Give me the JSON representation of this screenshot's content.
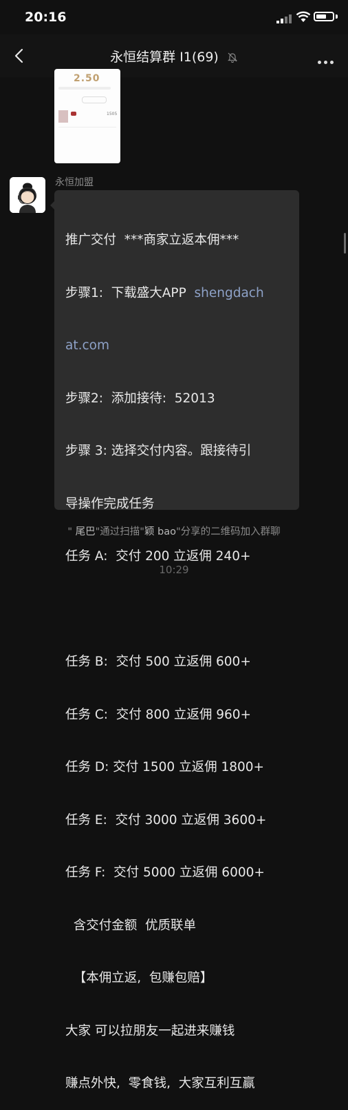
{
  "status": {
    "time": "20:16"
  },
  "nav": {
    "title": "永恒结算群 I1(69)"
  },
  "image_card": {
    "value": "2.50",
    "number": "1505"
  },
  "message": {
    "sender": "永恒加盟",
    "lines": [
      "推广交付  ***商家立返本佣***",
      "步骤1:  下载盛大APP  ",
      "at.com",
      "步骤2:  添加接待:  52013",
      "步骤 3: 选择交付内容。跟接待引",
      "导操作完成任务",
      "任务 A:  交付 200 立返佣 240+",
      "",
      "任务 B:  交付 500 立返佣 600+",
      "任务 C:  交付 800 立返佣 960+",
      "任务 D: 交付 1500 立返佣 1800+",
      "任务 E:  交付 3000 立返佣 3600+",
      "任务 F:  交付 5000 立返佣 6000+",
      "  含交付金额  优质联单",
      "  【本佣立返,  包赚包赔】",
      "大家 可以拉朋友一起进来赚钱",
      "赚点外快,  零食钱,  大家互利互赢"
    ],
    "link_part1": "shengdach"
  },
  "notice": {
    "q1": "\" ",
    "name1": "尾巴",
    "mid": "\"通过扫描\"",
    "name2": "颖 bao",
    "tail": "\"分享的二维码加入群聊"
  },
  "timestamp": "10:29"
}
